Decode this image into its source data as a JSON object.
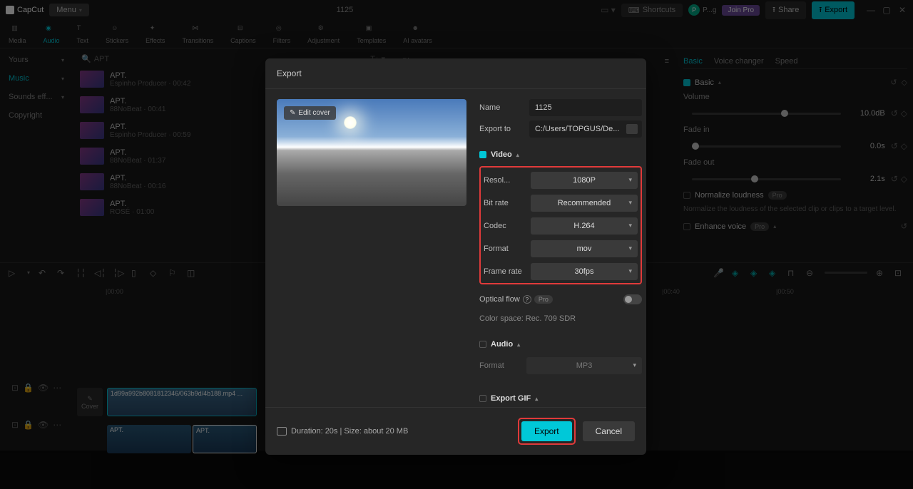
{
  "app": {
    "name": "CapCut",
    "menu_label": "Menu",
    "project_title": "1125"
  },
  "topbar": {
    "shortcuts_label": "Shortcuts",
    "user_initial": "P",
    "user_name": "P...g",
    "join_pro": "Join Pro",
    "share_label": "Share",
    "export_label": "Export"
  },
  "toolbar": {
    "items": [
      {
        "label": "Media"
      },
      {
        "label": "Audio"
      },
      {
        "label": "Text"
      },
      {
        "label": "Stickers"
      },
      {
        "label": "Effects"
      },
      {
        "label": "Transitions"
      },
      {
        "label": "Captions"
      },
      {
        "label": "Filters"
      },
      {
        "label": "Adjustment"
      },
      {
        "label": "Templates"
      },
      {
        "label": "AI avatars"
      }
    ]
  },
  "sidebar": {
    "tabs": [
      {
        "label": "Yours"
      },
      {
        "label": "Music"
      },
      {
        "label": "Sounds eff..."
      },
      {
        "label": "Copyright"
      }
    ]
  },
  "search": {
    "placeholder": "APT"
  },
  "media": {
    "items": [
      {
        "title": "APT.",
        "sub": "Espinho Producer · 00:42"
      },
      {
        "title": "APT.",
        "sub": "88NoBeat · 00:41"
      },
      {
        "title": "APT.",
        "sub": "Espinho Producer · 00:59"
      },
      {
        "title": "APT.",
        "sub": "88NoBeat · 01:37"
      },
      {
        "title": "APT.",
        "sub": "88NoBeat · 00:16"
      },
      {
        "title": "APT.",
        "sub": "ROSÉ · 01:00"
      }
    ]
  },
  "player": {
    "header": "Player"
  },
  "props": {
    "tabs": {
      "basic": "Basic",
      "voice": "Voice changer",
      "speed": "Speed"
    },
    "basic_section": "Basic",
    "volume": {
      "label": "Volume",
      "value": "10.0dB"
    },
    "fadein": {
      "label": "Fade in",
      "value": "0.0s"
    },
    "fadeout": {
      "label": "Fade out",
      "value": "2.1s"
    },
    "normalize": {
      "label": "Normalize loudness",
      "desc": "Normalize the loudness of the selected clip or clips to a target level."
    },
    "enhance": {
      "label": "Enhance voice"
    }
  },
  "ruler": {
    "t0": "|00:00",
    "t1": "|00:40",
    "t2": "|00:50"
  },
  "timeline": {
    "cover_label": "Cover",
    "video_clip": "1d99a992b8081812346/063b9d/4b188.mp4 ...",
    "audio1": "APT.",
    "audio2": "APT."
  },
  "modal": {
    "title": "Export",
    "edit_cover": "Edit cover",
    "name": {
      "label": "Name",
      "value": "1125"
    },
    "exportto": {
      "label": "Export to",
      "value": "C:/Users/TOPGUS/De..."
    },
    "video_section": "Video",
    "resolution": {
      "label": "Resol...",
      "value": "1080P"
    },
    "bitrate": {
      "label": "Bit rate",
      "value": "Recommended"
    },
    "codec": {
      "label": "Codec",
      "value": "H.264"
    },
    "format": {
      "label": "Format",
      "value": "mov"
    },
    "framerate": {
      "label": "Frame rate",
      "value": "30fps"
    },
    "optical": {
      "label": "Optical flow",
      "pro": "Pro"
    },
    "colorspace": "Color space: Rec. 709 SDR",
    "audio_section": "Audio",
    "audio_format": {
      "label": "Format",
      "value": "MP3"
    },
    "gif_section": "Export GIF",
    "duration": "Duration: 20s | Size: about 20 MB",
    "export_btn": "Export",
    "cancel_btn": "Cancel"
  }
}
